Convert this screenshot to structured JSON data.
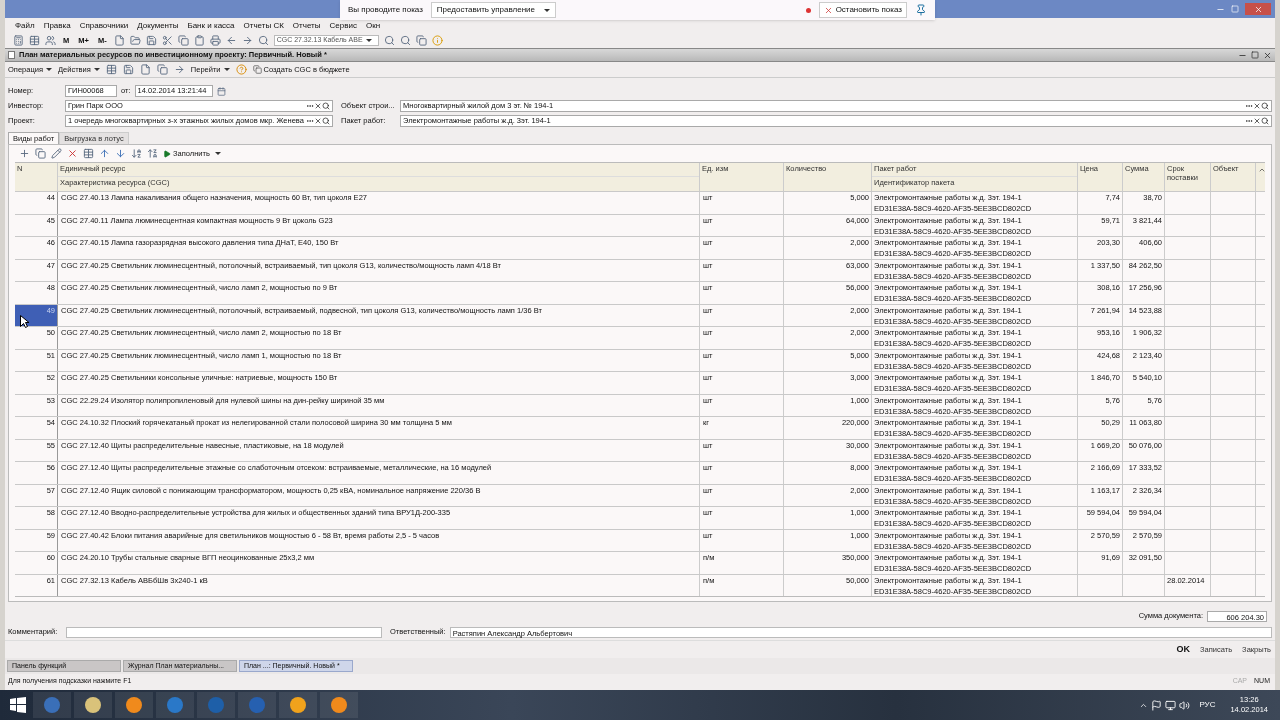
{
  "presentation_bar": {
    "status": "Вы проводите показ",
    "control_menu": "Предоставить управление",
    "stop_button": "Остановить показ"
  },
  "menu": [
    "Файл",
    "Правка",
    "Справочники",
    "Документы",
    "Банк и касса",
    "Отчеты СК",
    "Отчеты",
    "Сервис",
    "Окн"
  ],
  "toolbar": {
    "memory_buttons": [
      "M",
      "M+",
      "M-"
    ],
    "search_value": "CGC 27.32.13 Кабель АВЕ"
  },
  "document": {
    "title": "План материальных ресурсов по инвестиционному проекту: Первичный. Новый *",
    "actions": [
      {
        "label": "Операция",
        "kind": "menu"
      },
      {
        "label": "Действия",
        "kind": "menu"
      },
      {
        "label": "Перейти",
        "kind": "menu"
      },
      {
        "label": "Создать CGC в бюджете",
        "kind": "button"
      }
    ],
    "number": {
      "label": "Номер:",
      "value": "ГИН00068"
    },
    "date": {
      "label": "от:",
      "value": "14.02.2014 13:21:44"
    },
    "investor": {
      "label": "Инвестор:",
      "value": "Грин Парк ООО"
    },
    "project": {
      "label": "Проект:",
      "value": "1 очередь многоквартирных з-х этажных жилых домов мкр. Женева"
    },
    "object": {
      "label": "Объект строи...",
      "value": "Многоквартирный жилой дом 3 эт. № 194-1"
    },
    "work_package": {
      "label": "Пакет работ:",
      "value": "Электромонтажные работы ж.д. 3эт. 194-1"
    }
  },
  "tabs": [
    {
      "label": "Виды работ",
      "selected": true
    },
    {
      "label": "Выгрузка в лотус",
      "selected": false
    }
  ],
  "table_toolbar": {
    "fill_button": "Заполнить"
  },
  "table": {
    "columns": {
      "n": "N",
      "resource": "Единичный ресурс",
      "resource_sub": "Характеристика ресурса (CGC)",
      "unit": "Ед. изм",
      "quantity": "Количество",
      "package": "Пакет работ",
      "package_sub": "Идентификатор пакета",
      "price": "Цена",
      "sum": "Сумма",
      "delivery": "Срок поставки",
      "object": "Объект"
    },
    "rows": [
      {
        "n": "44",
        "resource": "CGC 27.40.13 Лампа накаливания общего назначения, мощность 60 Вт, тип цоколя E27",
        "unit": "шт",
        "quantity": "5,000",
        "package": "Электромонтажные работы ж.д. 3эт. 194-1",
        "package_id": "ED31E38A-58C9-4620-AF35-5EE3BCD802CD",
        "price": "7,74",
        "sum": "38,70",
        "selected": false
      },
      {
        "n": "45",
        "resource": "CGC 27.40.11 Лампа люминесцентная компактная мощность 9 Вт цоколь G23",
        "unit": "шт",
        "quantity": "64,000",
        "package": "Электромонтажные работы ж.д. 3эт. 194-1",
        "package_id": "ED31E38A-58C9-4620-AF35-5EE3BCD802CD",
        "price": "59,71",
        "sum": "3 821,44",
        "selected": false
      },
      {
        "n": "46",
        "resource": "CGC 27.40.15 Лампа газоразрядная высокого давления типа ДНаТ, E40, 150 Вт",
        "unit": "шт",
        "quantity": "2,000",
        "package": "Электромонтажные работы ж.д. 3эт. 194-1",
        "package_id": "ED31E38A-58C9-4620-AF35-5EE3BCD802CD",
        "price": "203,30",
        "sum": "406,60",
        "selected": false
      },
      {
        "n": "47",
        "resource": "CGC 27.40.25 Светильник люминесцентный, потолочный, встраиваемый, тип цоколя G13, количество/мощность ламп 4/18 Вт",
        "unit": "шт",
        "quantity": "63,000",
        "package": "Электромонтажные работы ж.д. 3эт. 194-1",
        "package_id": "ED31E38A-58C9-4620-AF35-5EE3BCD802CD",
        "price": "1 337,50",
        "sum": "84 262,50",
        "selected": false
      },
      {
        "n": "48",
        "resource": "CGC 27.40.25 Светильник люминесцентный, число ламп 2, мощностью по 9 Вт",
        "unit": "шт",
        "quantity": "56,000",
        "package": "Электромонтажные работы ж.д. 3эт. 194-1",
        "package_id": "ED31E38A-58C9-4620-AF35-5EE3BCD802CD",
        "price": "308,16",
        "sum": "17 256,96",
        "selected": false
      },
      {
        "n": "49",
        "resource": "CGC 27.40.25 Светильник люминесцентный, потолочный, встраиваемый, подвесной, тип цоколя G13, количество/мощность ламп 1/36 Вт",
        "unit": "шт",
        "quantity": "2,000",
        "package": "Электромонтажные работы ж.д. 3эт. 194-1",
        "package_id": "ED31E38A-58C9-4620-AF35-5EE3BCD802CD",
        "price": "7 261,94",
        "sum": "14 523,88",
        "selected": true
      },
      {
        "n": "50",
        "resource": "CGC 27.40.25 Светильник люминесцентный, число ламп 2, мощностью по 18 Вт",
        "unit": "шт",
        "quantity": "2,000",
        "package": "Электромонтажные работы ж.д. 3эт. 194-1",
        "package_id": "ED31E38A-58C9-4620-AF35-5EE3BCD802CD",
        "price": "953,16",
        "sum": "1 906,32",
        "selected": false
      },
      {
        "n": "51",
        "resource": "CGC 27.40.25 Светильник люминесцентный, число ламп 1, мощностью по 18 Вт",
        "unit": "шт",
        "quantity": "5,000",
        "package": "Электромонтажные работы ж.д. 3эт. 194-1",
        "package_id": "ED31E38A-58C9-4620-AF35-5EE3BCD802CD",
        "price": "424,68",
        "sum": "2 123,40",
        "selected": false
      },
      {
        "n": "52",
        "resource": "CGC 27.40.25 Светильники консольные уличные: натриевые, мощность 150 Вт",
        "unit": "шт",
        "quantity": "3,000",
        "package": "Электромонтажные работы ж.д. 3эт. 194-1",
        "package_id": "ED31E38A-58C9-4620-AF35-5EE3BCD802CD",
        "price": "1 846,70",
        "sum": "5 540,10",
        "selected": false
      },
      {
        "n": "53",
        "resource": "CGC 22.29.24 Изолятор полипропиленовый для нулевой шины на дин-рейку шириной 35 мм",
        "unit": "шт",
        "quantity": "1,000",
        "package": "Электромонтажные работы ж.д. 3эт. 194-1",
        "package_id": "ED31E38A-58C9-4620-AF35-5EE3BCD802CD",
        "price": "5,76",
        "sum": "5,76",
        "selected": false
      },
      {
        "n": "54",
        "resource": "CGC 24.10.32 Плоский горячекатаный прокат из нелегированной стали полосовой ширина 30 мм толщина 5 мм",
        "unit": "кг",
        "quantity": "220,000",
        "package": "Электромонтажные работы ж.д. 3эт. 194-1",
        "package_id": "ED31E38A-58C9-4620-AF35-5EE3BCD802CD",
        "price": "50,29",
        "sum": "11 063,80",
        "selected": false
      },
      {
        "n": "55",
        "resource": "CGC 27.12.40 Щиты распределительные навесные, пластиковые, на 18 модулей",
        "unit": "шт",
        "quantity": "30,000",
        "package": "Электромонтажные работы ж.д. 3эт. 194-1",
        "package_id": "ED31E38A-58C9-4620-AF35-5EE3BCD802CD",
        "price": "1 669,20",
        "sum": "50 076,00",
        "selected": false
      },
      {
        "n": "56",
        "resource": "CGC 27.12.40 Щиты распределительные этажные со слаботочным отсеком: встраиваемые, металлические, на 16 модулей",
        "unit": "шт",
        "quantity": "8,000",
        "package": "Электромонтажные работы ж.д. 3эт. 194-1",
        "package_id": "ED31E38A-58C9-4620-AF35-5EE3BCD802CD",
        "price": "2 166,69",
        "sum": "17 333,52",
        "selected": false
      },
      {
        "n": "57",
        "resource": "CGC 27.12.40 Ящик силовой с понижающим трансформатором, мощность 0,25 кВА, номинальное напряжение 220/36 В",
        "unit": "шт",
        "quantity": "2,000",
        "package": "Электромонтажные работы ж.д. 3эт. 194-1",
        "package_id": "ED31E38A-58C9-4620-AF35-5EE3BCD802CD",
        "price": "1 163,17",
        "sum": "2 326,34",
        "selected": false
      },
      {
        "n": "58",
        "resource": "CGC 27.12.40 Вводно-распределительные устройства для жилых и общественных зданий типа ВРУ1Д-200-335",
        "unit": "шт",
        "quantity": "1,000",
        "package": "Электромонтажные работы ж.д. 3эт. 194-1",
        "package_id": "ED31E38A-58C9-4620-AF35-5EE3BCD802CD",
        "price": "59 594,04",
        "sum": "59 594,04",
        "selected": false
      },
      {
        "n": "59",
        "resource": "CGC 27.40.42 Блоки питания аварийные для светильников мощностью 6 - 58 Вт, время работы 2,5 - 5 часов",
        "unit": "шт",
        "quantity": "1,000",
        "package": "Электромонтажные работы ж.д. 3эт. 194-1",
        "package_id": "ED31E38A-58C9-4620-AF35-5EE3BCD802CD",
        "price": "2 570,59",
        "sum": "2 570,59",
        "selected": false
      },
      {
        "n": "60",
        "resource": "CGC 24.20.10 Трубы стальные сварные ВГП неоцинкованные 25х3,2 мм",
        "unit": "п/м",
        "quantity": "350,000",
        "package": "Электромонтажные работы ж.д. 3эт. 194-1",
        "package_id": "ED31E38A-58C9-4620-AF35-5EE3BCD802CD",
        "price": "91,69",
        "sum": "32 091,50",
        "selected": false
      },
      {
        "n": "61",
        "resource": "CGC 27.32.13 Кабель АВБбШв 3х240-1 кВ",
        "unit": "п/м",
        "quantity": "50,000",
        "package": "Электромонтажные работы ж.д. 3эт. 194-1",
        "package_id": "ED31E38A-58C9-4620-AF35-5EE3BCD802CD",
        "delivery": "28.02.2014",
        "selected": false
      }
    ]
  },
  "total": {
    "label": "Сумма документа:",
    "value": "606 204.30"
  },
  "comment": {
    "label": "Комментарий:"
  },
  "responsible": {
    "label": "Ответственный:",
    "value": "Растяпин Александр Альбертович"
  },
  "footer_buttons": [
    {
      "label": "OK",
      "kind": "default"
    },
    {
      "label": "Записать",
      "kind": "normal"
    },
    {
      "label": "Закрыть",
      "kind": "normal"
    }
  ],
  "window_tabs": [
    {
      "label": "Панель функций",
      "selected": false
    },
    {
      "label": "Журнал План материальны...",
      "selected": false
    },
    {
      "label": "План ...: Первичный. Новый *",
      "selected": true
    }
  ],
  "status_bar": {
    "hint": "Для получения подсказки нажмите F1",
    "indicators": [
      {
        "label": "CAP",
        "on": false
      },
      {
        "label": "NUM",
        "on": true
      }
    ]
  },
  "taskbar": {
    "language": "РУС",
    "time": "13:26",
    "date": "14.02.2014"
  }
}
